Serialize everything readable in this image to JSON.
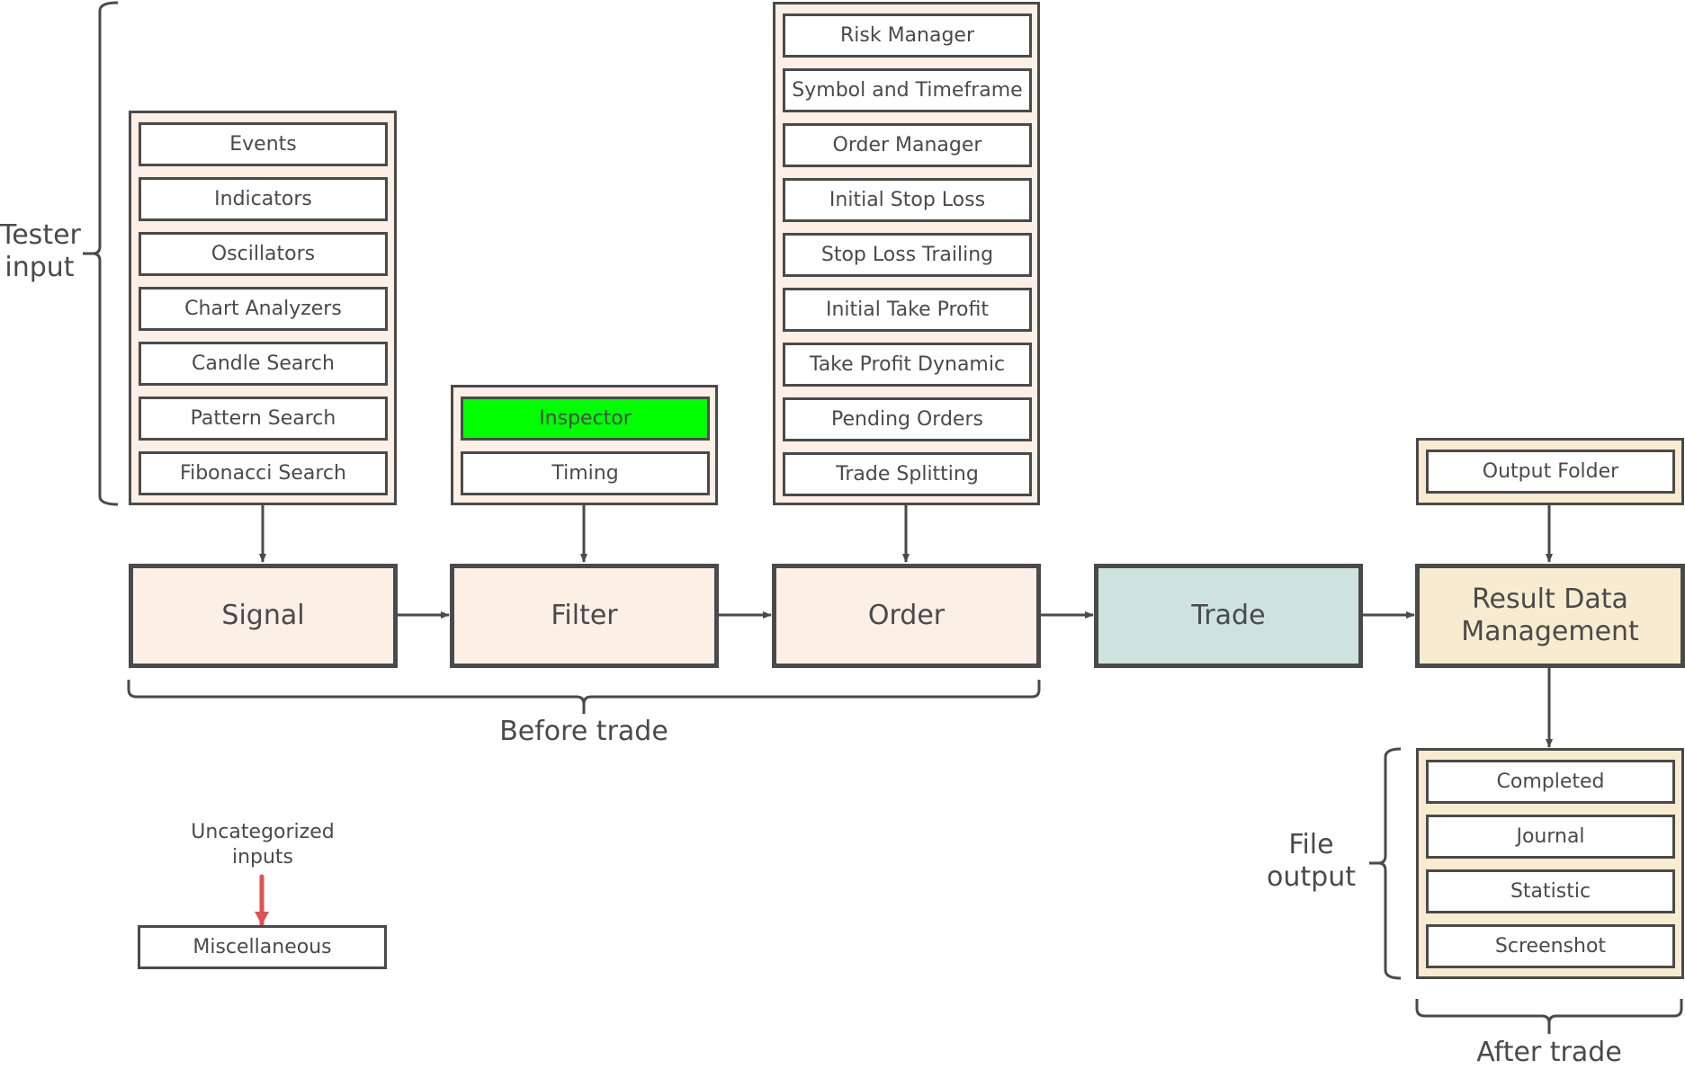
{
  "diagram": {
    "colors": {
      "stroke": "#4a4a4a",
      "peach": "#fcefe6",
      "teal": "#cfe3de",
      "yellow": "#f8ecd0",
      "highlight": "#00ff00",
      "red_arrow": "#e05252"
    },
    "brace_labels": {
      "tester_input": [
        "Tester",
        "input"
      ],
      "before_trade": "Before trade",
      "file_output": [
        "File",
        "output"
      ],
      "after_trade": "After trade"
    },
    "stages": [
      {
        "id": "signal",
        "label": "Signal"
      },
      {
        "id": "filter",
        "label": "Filter"
      },
      {
        "id": "order",
        "label": "Order"
      },
      {
        "id": "trade",
        "label": "Trade"
      },
      {
        "id": "result",
        "label_lines": [
          "Result Data",
          "Management"
        ]
      }
    ],
    "signal_inputs": [
      "Events",
      "Indicators",
      "Oscillators",
      "Chart Analyzers",
      "Candle Search",
      "Pattern Search",
      "Fibonacci Search"
    ],
    "filter_inputs": [
      {
        "label": "Inspector",
        "highlighted": true
      },
      {
        "label": "Timing",
        "highlighted": false
      }
    ],
    "order_inputs": [
      "Risk Manager",
      "Symbol and Timeframe",
      "Order Manager",
      "Initial Stop Loss",
      "Stop Loss Trailing",
      "Initial Take Profit",
      "Take Profit Dynamic",
      "Pending Orders",
      "Trade Splitting"
    ],
    "result_inputs": [
      "Output Folder"
    ],
    "file_outputs": [
      "Completed",
      "Journal",
      "Statistic",
      "Screenshot"
    ],
    "uncategorized": {
      "label_lines": [
        "Uncategorized",
        "inputs"
      ],
      "item": "Miscellaneous"
    }
  }
}
